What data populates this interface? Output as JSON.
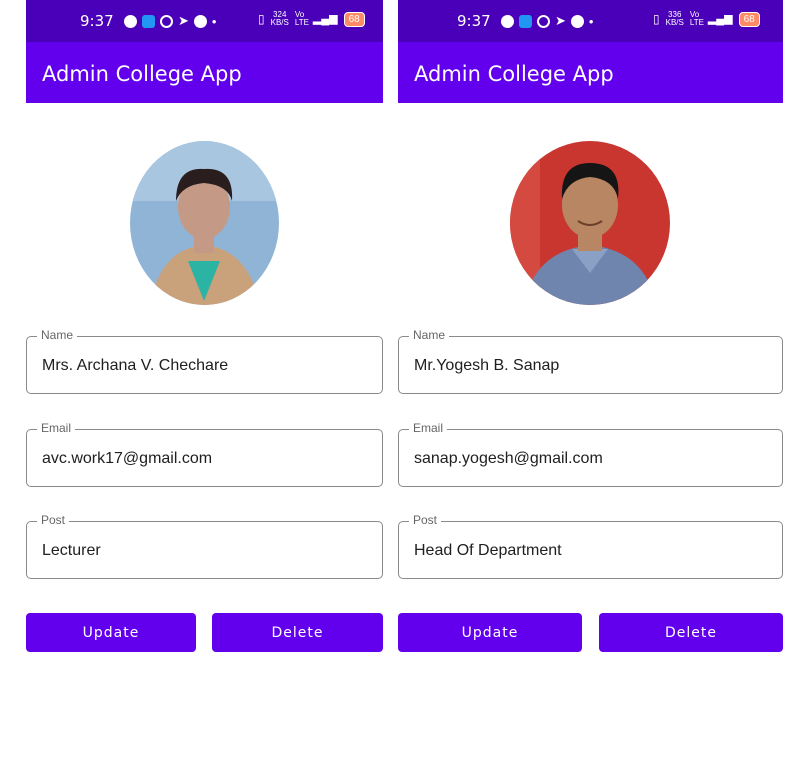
{
  "screens": [
    {
      "status": {
        "time": "9:37",
        "speed": "324",
        "speed_unit": "KB/S",
        "net": "Vo LTE",
        "signal": "4G+",
        "battery": "68"
      },
      "app_title": "Admin College App",
      "avatar": {
        "bg": "#8fb4d6",
        "skin": "#c49a86",
        "hair": "#2a1d1d",
        "clothes": "#c9a17a",
        "accent": "#2bb3a3"
      },
      "fields": {
        "name": {
          "label": "Name",
          "value": "Mrs. Archana V. Chechare"
        },
        "email": {
          "label": "Email",
          "value": "avc.work17@gmail.com"
        },
        "post": {
          "label": "Post",
          "value": "Lecturer"
        }
      },
      "buttons": {
        "update": "Update",
        "delete": "Delete"
      }
    },
    {
      "status": {
        "time": "9:37",
        "speed": "336",
        "speed_unit": "KB/S",
        "net": "Vo LTE",
        "signal": "4G+",
        "battery": "68"
      },
      "app_title": "Admin College App",
      "avatar": {
        "bg": "#c8362f",
        "skin": "#b98664",
        "hair": "#151515",
        "clothes": "#6f85ad",
        "accent": "#8aa0c4"
      },
      "fields": {
        "name": {
          "label": "Name",
          "value": "Mr.Yogesh B. Sanap"
        },
        "email": {
          "label": "Email",
          "value": "sanap.yogesh@gmail.com"
        },
        "post": {
          "label": "Post",
          "value": "Head Of Department"
        }
      },
      "buttons": {
        "update": "Update",
        "delete": "Delete"
      }
    }
  ],
  "colors": {
    "primary": "#6200ee",
    "status_bar": "#4a00b8"
  }
}
